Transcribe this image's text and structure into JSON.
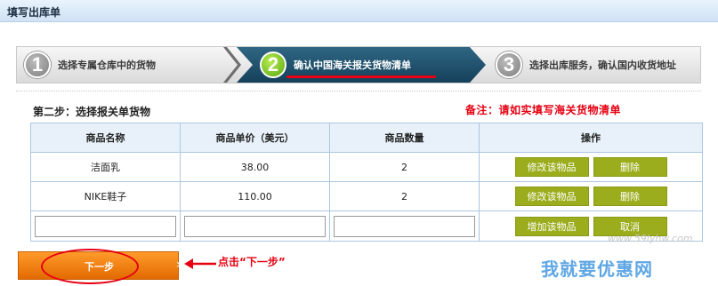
{
  "header": {
    "title": "填写出库单"
  },
  "steps": [
    {
      "number": "1",
      "label": "选择专属仓库中的货物"
    },
    {
      "number": "2",
      "label": "确认中国海关报关货物清单"
    },
    {
      "number": "3",
      "label": "选择出库服务，确认国内收货地址"
    }
  ],
  "section": {
    "title": "第二步：选择报关单货物",
    "remark": "备注：请如实填写海关货物清单"
  },
  "table": {
    "headers": [
      "商品名称",
      "商品单价（美元）",
      "商品数量",
      "操作"
    ],
    "rows": [
      {
        "name": "洁面乳",
        "price": "38.00",
        "qty": "2"
      },
      {
        "name": "NIKE鞋子",
        "price": "110.00",
        "qty": "2"
      }
    ],
    "edit_label": "修改该物品",
    "delete_label": "删除",
    "add_label": "增加该物品",
    "cancel_label": "取消"
  },
  "next_button": {
    "label": "下一步"
  },
  "annotation": {
    "hint": "点击“下一步”"
  },
  "watermark": {
    "url": "www.59lyhw.com",
    "logo": "我就要优惠网"
  }
}
